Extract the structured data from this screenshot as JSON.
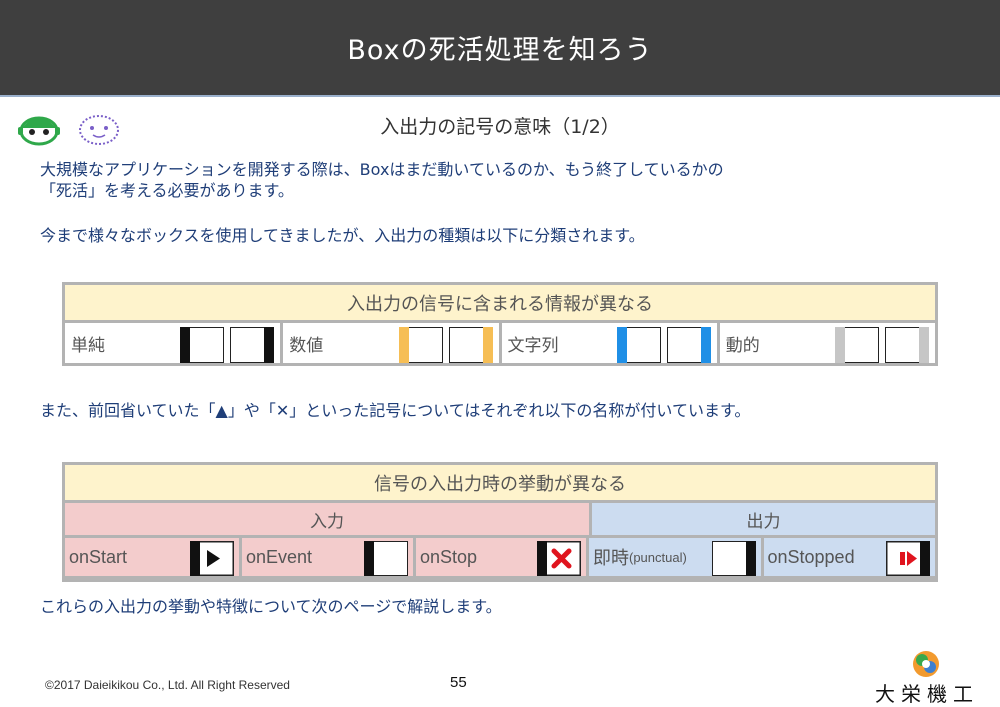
{
  "header": {
    "title": "Boxの死活処理を知ろう"
  },
  "subtitle": "入出力の記号の意味（1/2）",
  "paragraphs": {
    "p1_line1": "大規模なアプリケーションを開発する際は、Boxはまだ動いているのか、もう終了しているかの",
    "p1_line2": "「死活」を考える必要があります。",
    "p2": "今まで様々なボックスを使用してきましたが、入出力の種類は以下に分類されます。",
    "p3": "また、前回省いていた「▲」や「✕」といった記号についてはそれぞれ以下の名称が付いています。",
    "p4": "これらの入出力の挙動や特徴について次のページで解説します。"
  },
  "table1": {
    "header": "入出力の信号に含まれる情報が異なる",
    "cells": [
      {
        "label": "単純",
        "color": "#111111"
      },
      {
        "label": "数値",
        "color": "#f6be55"
      },
      {
        "label": "文字列",
        "color": "#1f8fe6"
      },
      {
        "label": "動的",
        "color": "#c6c6c6"
      }
    ]
  },
  "table2": {
    "header": "信号の入出力時の挙動が異なる",
    "group_in": "入力",
    "group_out": "出力",
    "cells": [
      {
        "label": "onStart",
        "symbol": "play-icon"
      },
      {
        "label": "onEvent",
        "symbol": "bar-left-icon"
      },
      {
        "label": "onStop",
        "symbol": "red-x-icon"
      },
      {
        "label": "即時",
        "small": "(punctual)",
        "symbol": "bar-right-icon"
      },
      {
        "label": "onStopped",
        "symbol": "stopped-icon"
      }
    ],
    "accent_red": "#e0141e"
  },
  "footer": {
    "copyright": "©2017 Daieikikou Co., Ltd. All Right Reserved",
    "page": "55",
    "company": "大栄機工"
  }
}
